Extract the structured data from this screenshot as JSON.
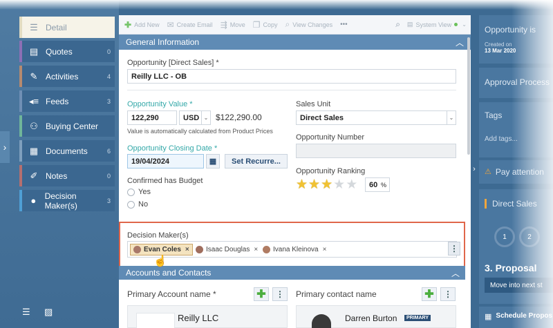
{
  "sidebar": {
    "items": [
      {
        "label": "Detail",
        "count": "",
        "icon": "detail-icon"
      },
      {
        "label": "Quotes",
        "count": "0",
        "icon": "quotes-icon"
      },
      {
        "label": "Activities",
        "count": "4",
        "icon": "activities-icon"
      },
      {
        "label": "Feeds",
        "count": "3",
        "icon": "feeds-icon"
      },
      {
        "label": "Buying Center",
        "count": "",
        "icon": "buying-center-icon"
      },
      {
        "label": "Documents",
        "count": "6",
        "icon": "documents-icon"
      },
      {
        "label": "Notes",
        "count": "0",
        "icon": "notes-icon"
      },
      {
        "label": "Decision Maker(s)",
        "count": "3",
        "icon": "person-icon"
      }
    ]
  },
  "toolbar": {
    "add_new": "Add New",
    "create_email": "Create Email",
    "move": "Move",
    "copy": "Copy",
    "view_changes": "View Changes",
    "more": "•••",
    "system_view": "System View"
  },
  "general": {
    "section_title": "General Information",
    "opportunity_label": "Opportunity [Direct Sales] *",
    "opportunity_value": "Reilly LLC - OB",
    "value_label": "Opportunity Value *",
    "value_amount": "122,290",
    "currency": "USD",
    "value_formatted": "$122,290.00",
    "value_hint": "Value is automatically calculated from Product Prices",
    "sales_unit_label": "Sales Unit",
    "sales_unit_value": "Direct Sales",
    "closing_date_label": "Opportunity Closing Date *",
    "closing_date_value": "19/04/2024",
    "set_recurrence": "Set Recurre...",
    "opp_number_label": "Opportunity Number",
    "opp_number_value": "",
    "budget_label": "Confirmed has Budget",
    "budget_yes": "Yes",
    "budget_no": "No",
    "ranking_label": "Opportunity Ranking",
    "ranking_stars": 3,
    "ranking_max": 5,
    "ranking_percent": "60",
    "percent_sign": "%"
  },
  "decision_makers": {
    "label": "Decision Maker(s)",
    "chips": [
      {
        "name": "Evan Coles",
        "selected": true
      },
      {
        "name": "Isaac Douglas",
        "selected": false
      },
      {
        "name": "Ivana Kleinova",
        "selected": false
      }
    ],
    "remove_glyph": "×"
  },
  "accounts": {
    "section_title": "Accounts and Contacts",
    "primary_account_label": "Primary Account name *",
    "primary_account_value": "Reilly LLC",
    "primary_contact_label": "Primary contact name",
    "primary_contact_value": "Darren Burton",
    "primary_badge": "PRIMARY"
  },
  "right_panel": {
    "opportunity_title": "Opportunity is",
    "created_on_label": "Created on",
    "created_on_value": "13 Mar 2020",
    "approval": "Approval Process",
    "tags": "Tags",
    "add_tags": "Add tags...",
    "attention": "Pay attention",
    "direct_sales": "Direct Sales",
    "stage1": "1",
    "stage2": "2",
    "proposal": "3. Proposal",
    "move_next": "Move into next st",
    "schedule": "Schedule Propos"
  }
}
